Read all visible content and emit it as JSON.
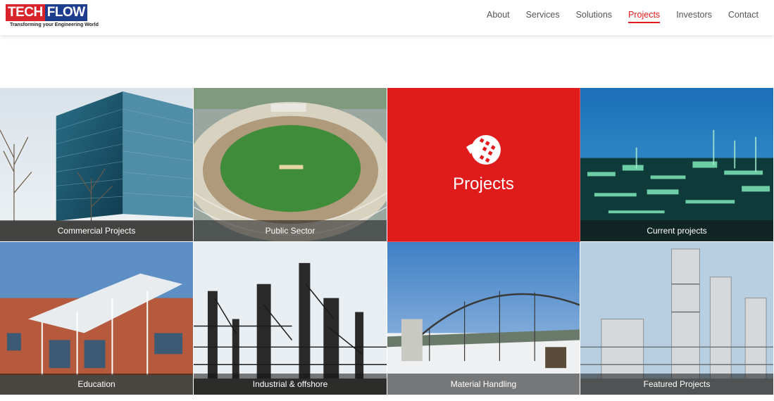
{
  "brand": {
    "name_left": "TECH",
    "name_right": "FLOW",
    "tagline": "Transforming your Engineering World",
    "colors": {
      "red": "#d8232a",
      "blue": "#1f3d8f"
    }
  },
  "nav": {
    "items": [
      {
        "label": "About"
      },
      {
        "label": "Services"
      },
      {
        "label": "Solutions"
      },
      {
        "label": "Projects",
        "active": true
      },
      {
        "label": "Investors"
      },
      {
        "label": "Contact"
      }
    ],
    "active_color": "#e01b1b"
  },
  "hero": {
    "title": "Projects",
    "icon": "globe-icon",
    "background": "#e01b1b"
  },
  "tiles": [
    {
      "label": "Commercial Projects",
      "image": "office-building-image"
    },
    {
      "label": "Public Sector",
      "image": "stadium-image"
    },
    {
      "label": "Current projects",
      "image": "refinery-night-image"
    },
    {
      "label": "Education",
      "image": "school-building-image"
    },
    {
      "label": "Industrial & offshore",
      "image": "industrial-plant-image"
    },
    {
      "label": "Material Handling",
      "image": "conveyor-snow-image"
    },
    {
      "label": "Featured Projects",
      "image": "chemical-plant-image"
    }
  ]
}
